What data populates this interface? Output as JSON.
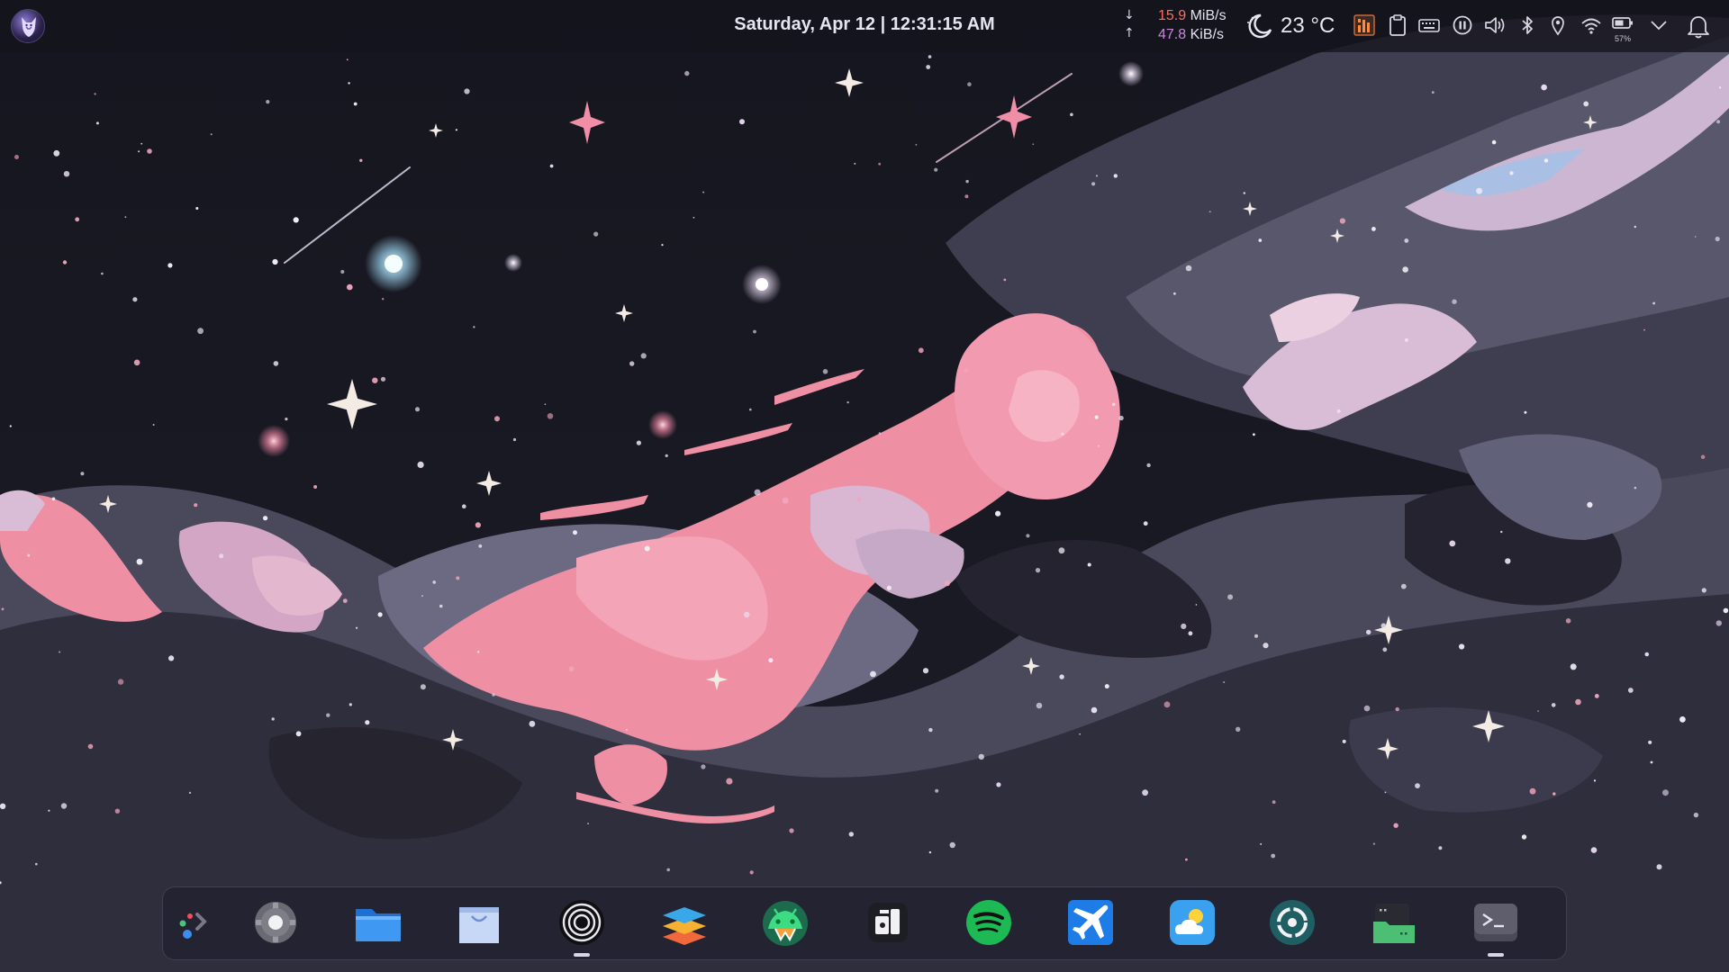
{
  "topbar": {
    "datetime": "Saturday, Apr 12 | 12:31:15 AM",
    "network": {
      "down_value": "15.9",
      "down_unit": "MiB/s",
      "up_value": "47.8",
      "up_unit": "KiB/s",
      "down_arrow": "↓",
      "up_arrow": "↑"
    },
    "weather": {
      "icon": "moon-icon",
      "temperature": "23 °C"
    },
    "battery_percent": "57%",
    "tray_icons": [
      "system-monitor-icon",
      "clipboard-icon",
      "keyboard-icon",
      "media-pause-icon",
      "volume-icon",
      "bluetooth-icon",
      "location-icon",
      "wifi-icon",
      "battery-icon",
      "chevron-down-icon",
      "bell-icon"
    ]
  },
  "dock": {
    "apps": [
      {
        "name": "app-launcher",
        "icon": "app-grid-icon"
      },
      {
        "name": "settings",
        "icon": "gear-icon"
      },
      {
        "name": "files",
        "icon": "folder-icon"
      },
      {
        "name": "store",
        "icon": "shopping-bag-icon"
      },
      {
        "name": "vinyl-player",
        "icon": "record-icon",
        "running": true
      },
      {
        "name": "stacks",
        "icon": "layers-icon"
      },
      {
        "name": "android-studio",
        "icon": "android-icon"
      },
      {
        "name": "widgets",
        "icon": "widget-icon"
      },
      {
        "name": "spotify",
        "icon": "spotify-icon"
      },
      {
        "name": "travel",
        "icon": "airplane-icon"
      },
      {
        "name": "weather",
        "icon": "weather-sun-cloud-icon"
      },
      {
        "name": "camera",
        "icon": "lens-icon"
      },
      {
        "name": "file-manager-green",
        "icon": "folder-green-icon"
      },
      {
        "name": "terminal",
        "icon": "terminal-icon",
        "running": true
      }
    ]
  },
  "colors": {
    "sky": "#1b1b27",
    "cloud_pink": "#ef8fa4",
    "cloud_light": "#d9b6d2",
    "cloud_gray": "#5d5c70",
    "cloud_dark": "#2c2b39",
    "net_down": "#ff6b5e",
    "net_up": "#c788d8"
  }
}
